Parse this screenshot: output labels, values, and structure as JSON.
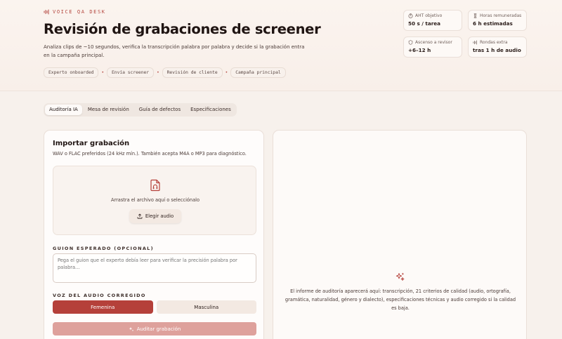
{
  "header": {
    "brand": "VOICE QA DESK",
    "title": "Revisión de grabaciones de screener",
    "subtitle": "Analiza clips de ~10 segundos, verifica la transcripción palabra por palabra y decide si la grabación entra en la campaña principal.",
    "steps": [
      "Experto onboarded",
      "Envía screener",
      "Revisión de cliente",
      "Campaña principal"
    ],
    "step_separator": "•",
    "stats": [
      {
        "icon": "timer-icon",
        "label": "AHT objetivo",
        "value": "50 s / tarea"
      },
      {
        "icon": "hourglass-icon",
        "label": "Horas remuneradas",
        "value": "6 h estimadas"
      },
      {
        "icon": "shield-icon",
        "label": "Ascenso a revisor",
        "value": "+6–12 h"
      },
      {
        "icon": "waveform-icon",
        "label": "Rondas extra",
        "value": "tras 1 h de audio"
      }
    ]
  },
  "tabs": [
    "Auditoría IA",
    "Mesa de revisión",
    "Guía de defectos",
    "Especificaciones"
  ],
  "active_tab": "Auditoría IA",
  "import": {
    "title": "Importar grabación",
    "description": "WAV o FLAC preferidos (24 kHz mín.). También acepta M4A o MP3 para diagnóstico.",
    "dropzone_text": "Arrastra el archivo aquí o selecciónalo",
    "choose_label": "Elegir audio",
    "script_label": "GUION ESPERADO (OPCIONAL)",
    "script_placeholder": "Pega el guion que el experto debía leer para verificar la precisión palabra por palabra…",
    "voice_label": "VOZ DEL AUDIO CORREGIDO",
    "voice_options": [
      "Femenina",
      "Masculina"
    ],
    "voice_selected": "Femenina",
    "audit_label": "Auditar grabación"
  },
  "report": {
    "placeholder": "El informe de auditoría aparecerá aquí: transcripción, 21 criterios de calidad (audio, ortografía, gramática, naturalidad, género y dialecto), especificaciones técnicas y audio corregido si la calidad es baja."
  },
  "colors": {
    "accent": "#b5403a",
    "accent_disabled": "#dea19c",
    "background": "#f7f1ec"
  }
}
